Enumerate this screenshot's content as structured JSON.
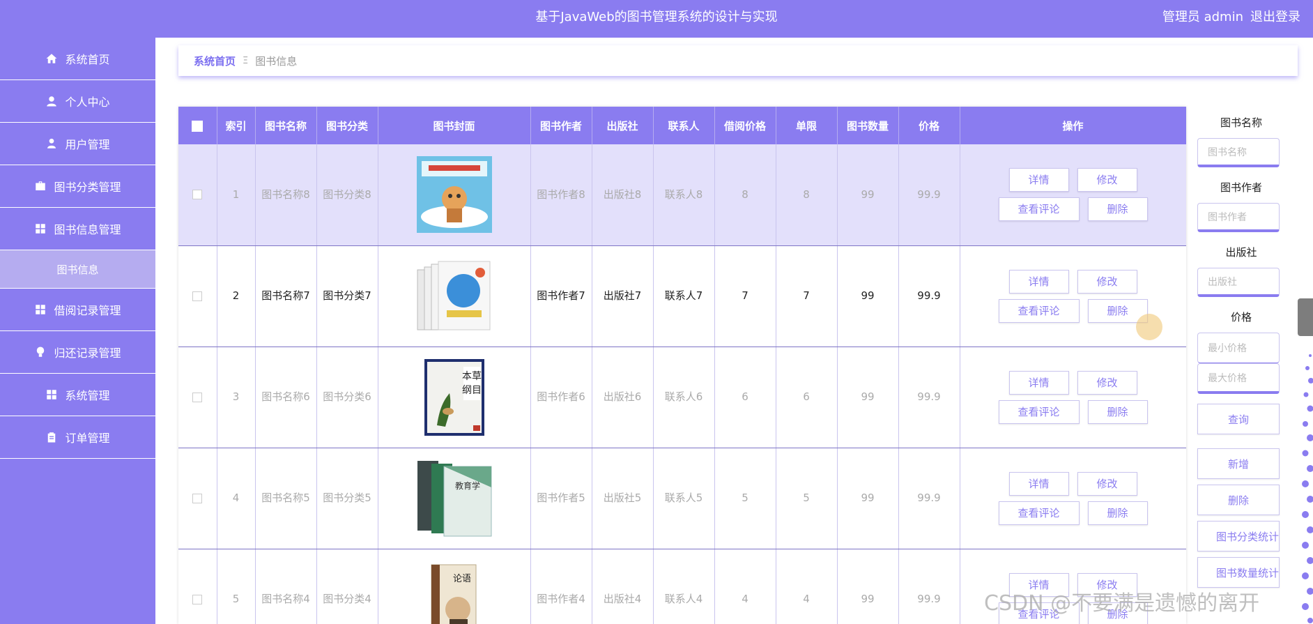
{
  "header": {
    "title": "基于JavaWeb的图书管理系统的设计与实现",
    "user_label": "管理员 admin",
    "logout": "退出登录"
  },
  "sidebar": {
    "items": [
      {
        "label": "系统首页",
        "icon": "home-icon"
      },
      {
        "label": "个人中心",
        "icon": "user-icon"
      },
      {
        "label": "用户管理",
        "icon": "user-admin-icon"
      },
      {
        "label": "图书分类管理",
        "icon": "briefcase-icon"
      },
      {
        "label": "图书信息管理",
        "icon": "grid-icon"
      },
      {
        "label": "图书信息",
        "icon": ""
      },
      {
        "label": "借阅记录管理",
        "icon": "grid-icon"
      },
      {
        "label": "归还记录管理",
        "icon": "bulb-icon"
      },
      {
        "label": "系统管理",
        "icon": "grid-icon"
      },
      {
        "label": "订单管理",
        "icon": "clipboard-icon"
      }
    ]
  },
  "breadcrumb": {
    "home": "系统首页",
    "separator": "Ξ",
    "current": "图书信息"
  },
  "table": {
    "headers": [
      "索引",
      "图书名称",
      "图书分类",
      "图书封面",
      "图书作者",
      "出版社",
      "联系人",
      "借阅价格",
      "单限",
      "图书数量",
      "价格",
      "操作"
    ],
    "rows": [
      {
        "index": "1",
        "name": "图书名称8",
        "category": "图书分类8",
        "author": "图书作者8",
        "publisher": "出版社8",
        "contact": "联系人8",
        "borrow_price": "8",
        "limit": "8",
        "quantity": "99",
        "price": "99.9"
      },
      {
        "index": "2",
        "name": "图书名称7",
        "category": "图书分类7",
        "author": "图书作者7",
        "publisher": "出版社7",
        "contact": "联系人7",
        "borrow_price": "7",
        "limit": "7",
        "quantity": "99",
        "price": "99.9"
      },
      {
        "index": "3",
        "name": "图书名称6",
        "category": "图书分类6",
        "author": "图书作者6",
        "publisher": "出版社6",
        "contact": "联系人6",
        "borrow_price": "6",
        "limit": "6",
        "quantity": "99",
        "price": "99.9"
      },
      {
        "index": "4",
        "name": "图书名称5",
        "category": "图书分类5",
        "author": "图书作者5",
        "publisher": "出版社5",
        "contact": "联系人5",
        "borrow_price": "5",
        "limit": "5",
        "quantity": "99",
        "price": "99.9"
      },
      {
        "index": "5",
        "name": "图书名称4",
        "category": "图书分类4",
        "author": "图书作者4",
        "publisher": "出版社4",
        "contact": "联系人4",
        "borrow_price": "4",
        "limit": "4",
        "quantity": "99",
        "price": "99.9"
      }
    ],
    "actions": {
      "detail": "详情",
      "edit": "修改",
      "comments": "查看评论",
      "delete": "删除"
    }
  },
  "search_panel": {
    "book_name_label": "图书名称",
    "book_name_placeholder": "图书名称",
    "author_label": "图书作者",
    "author_placeholder": "图书作者",
    "publisher_label": "出版社",
    "publisher_placeholder": "出版社",
    "price_label": "价格",
    "min_price_placeholder": "最小价格",
    "max_price_placeholder": "最大价格",
    "query_button": "查询",
    "add_button": "新增",
    "delete_button": "删除",
    "category_stats_button": "图书分类统计",
    "quantity_stats_button": "图书数量统计"
  },
  "watermark": "CSDN @不要满是遗憾的离开",
  "colors": {
    "accent": "#8a7cf0",
    "light_accent": "#b5acf0",
    "highlight_row": "#e3e0fb"
  }
}
